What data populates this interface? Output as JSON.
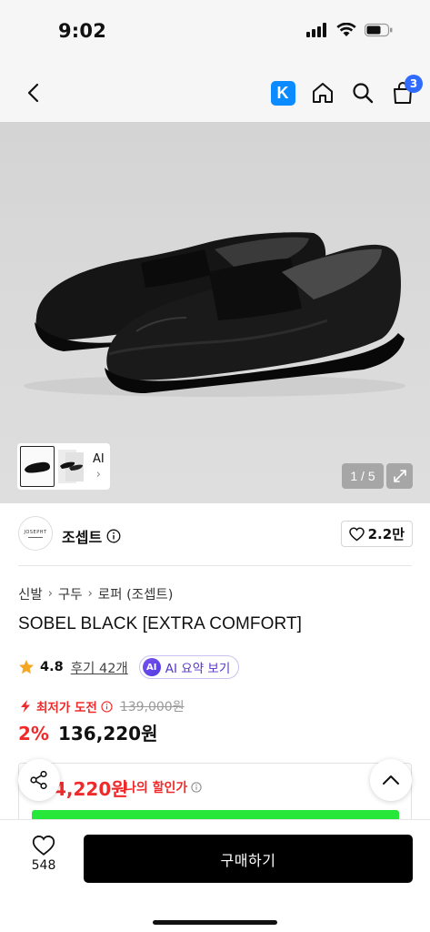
{
  "status_bar": {
    "time": "9:02"
  },
  "nav": {
    "cart_count": "3",
    "k_label": "K"
  },
  "gallery": {
    "thumb_ai_label": "AI",
    "counter": "1 / 5"
  },
  "brand": {
    "name": "조셉트",
    "logo_text": "JOSEPHT",
    "likes": "2.2만"
  },
  "breadcrumb": [
    "신발",
    "구두",
    "로퍼 (조셉트)"
  ],
  "product": {
    "title": "SOBEL BLACK [EXTRA COMFORT]",
    "rating": "4.8",
    "reviews": "후기 42개",
    "ai_summary_label": "AI 요약 보기",
    "ai_badge": "AI",
    "lowest_label": "최저가 도전",
    "original_price": "139,000원",
    "discount": "2%",
    "price": "136,220원",
    "my_deal_price": "4,220원",
    "my_deal_label": "나의 할인가"
  },
  "bottom": {
    "wish_count": "548",
    "buy_label": "구매하기"
  },
  "colors": {
    "accent_red": "#ef2a2a",
    "ai_purple": "#5636c8",
    "k_blue": "#0a8bff",
    "cart_badge": "#2f6bff"
  }
}
